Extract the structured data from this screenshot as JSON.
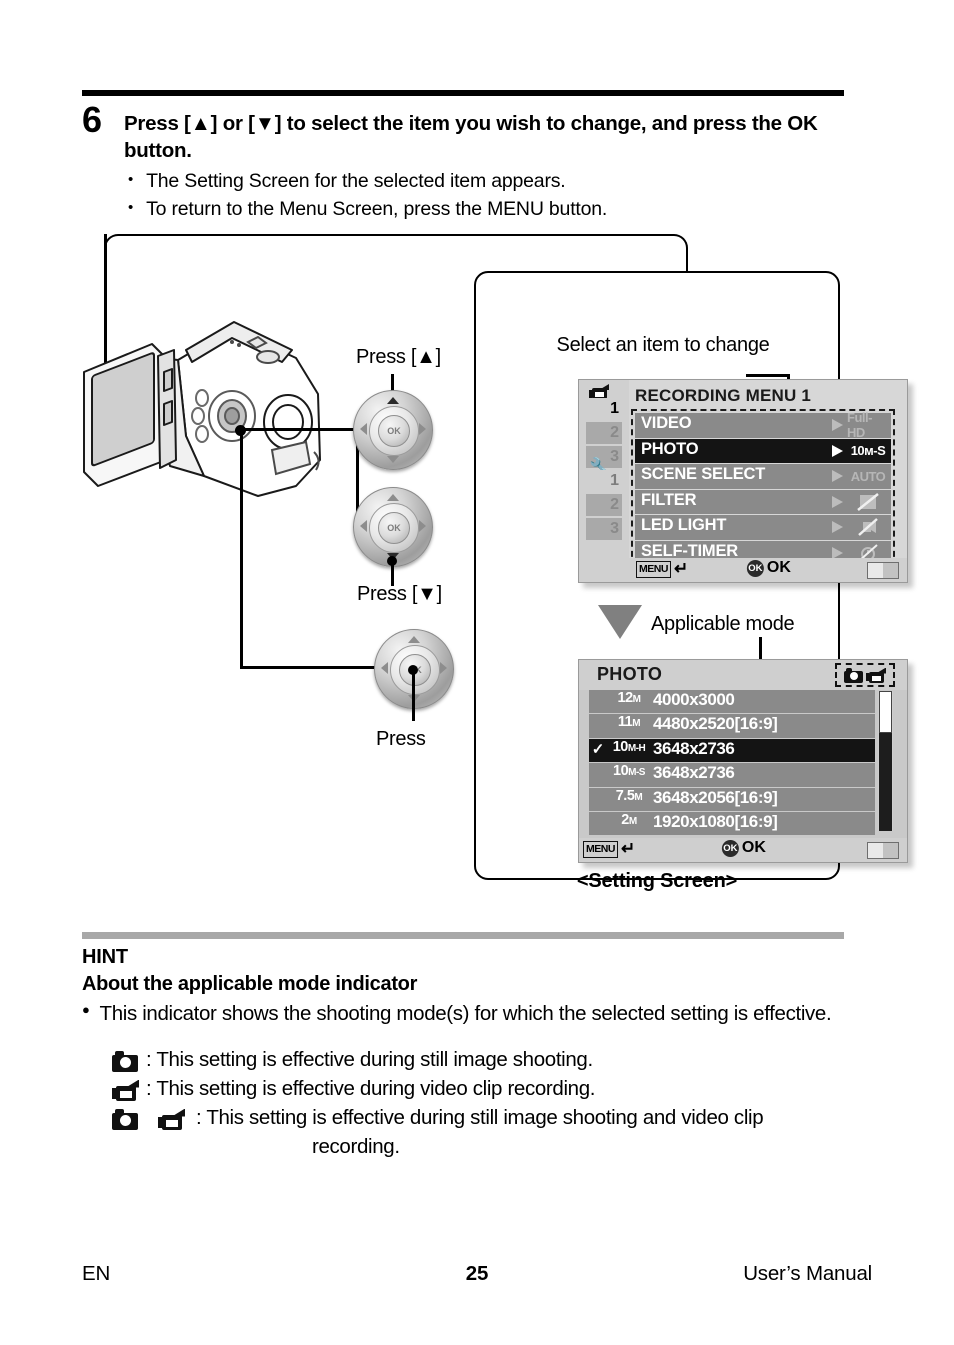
{
  "step": {
    "number": "6",
    "heading": "Press [▲] or [▼] to select the item you wish to change, and press the OK button.",
    "bullets": [
      "The Setting Screen for the selected item appears.",
      "To return to the Menu Screen, press the MENU button."
    ]
  },
  "illustration": {
    "press_up_label": "Press [▲]",
    "press_down_label": "Press [▼]",
    "press_label": "Press",
    "ok_glyph": "OK",
    "select_item_callout": "Select an item to change",
    "applicable_mode_callout": "Applicable mode",
    "setting_screen_caption": "<Setting Screen>"
  },
  "recording_menu": {
    "title": "RECORDING MENU 1",
    "tabs": [
      {
        "icon": "camera-video-icon",
        "label": "1",
        "active": true
      },
      {
        "label": "2",
        "active": false
      },
      {
        "label": "3",
        "active": false
      },
      {
        "icon": "wrench-icon",
        "label": "1",
        "active": false
      },
      {
        "label": "2",
        "active": false
      },
      {
        "label": "3",
        "active": false
      }
    ],
    "items": [
      {
        "label": "VIDEO",
        "value": "Full-HD",
        "selected": false
      },
      {
        "label": "PHOTO",
        "value": "10ᴍ-S",
        "selected": true
      },
      {
        "label": "SCENE SELECT",
        "value": "AUTO",
        "selected": false
      },
      {
        "label": "FILTER",
        "value": "filter-off-icon",
        "selected": false
      },
      {
        "label": "LED LIGHT",
        "value": "led-off-icon",
        "selected": false
      },
      {
        "label": "SELF-TIMER",
        "value": "self-timer-off-icon",
        "selected": false
      }
    ],
    "footer": {
      "menu_key": "MENU",
      "back_glyph": "↵",
      "ok_key": "OK",
      "ok_label": "OK"
    }
  },
  "photo_screen": {
    "title": "PHOTO",
    "mode_indicator": [
      "still-image-icon",
      "video-clip-icon"
    ],
    "options": [
      {
        "mp": "12",
        "unit": "M",
        "resolution": "4000x3000",
        "checked": false,
        "selected": false
      },
      {
        "mp": "11",
        "unit": "M",
        "resolution": "4480x2520[16:9]",
        "checked": false,
        "selected": false
      },
      {
        "mp": "10",
        "unit": "M-H",
        "resolution": "3648x2736",
        "checked": true,
        "selected": true
      },
      {
        "mp": "10",
        "unit": "M-S",
        "resolution": "3648x2736",
        "checked": false,
        "selected": false
      },
      {
        "mp": "7.5",
        "unit": "M",
        "resolution": "3648x2056[16:9]",
        "checked": false,
        "selected": false
      },
      {
        "mp": "2",
        "unit": "M",
        "resolution": "1920x1080[16:9]",
        "checked": false,
        "selected": false
      }
    ],
    "footer": {
      "menu_key": "MENU",
      "back_glyph": "↵",
      "ok_key": "OK",
      "ok_label": "OK"
    }
  },
  "hint": {
    "title": "HINT",
    "subtitle": "About the applicable mode indicator",
    "bullet": "This indicator shows the shooting mode(s) for which the selected setting is effective.",
    "rows": [
      {
        "icons": [
          "still-image-icon"
        ],
        "text": ": This setting is effective during still image shooting."
      },
      {
        "icons": [
          "video-clip-icon"
        ],
        "text": ": This setting is effective during video clip recording."
      },
      {
        "icons": [
          "still-image-icon",
          "video-clip-icon"
        ],
        "text": ": This setting is effective during still image shooting and video clip",
        "cont": "recording."
      }
    ]
  },
  "footer": {
    "language": "EN",
    "page": "25",
    "manual": "User’s Manual"
  },
  "colors": {
    "rule": "#000000",
    "hint_rule": "#a8a8a8",
    "menu_row": "#8a8a8a",
    "menu_row_selected": "#141414",
    "lcd_chrome": "#d0d0d0"
  }
}
